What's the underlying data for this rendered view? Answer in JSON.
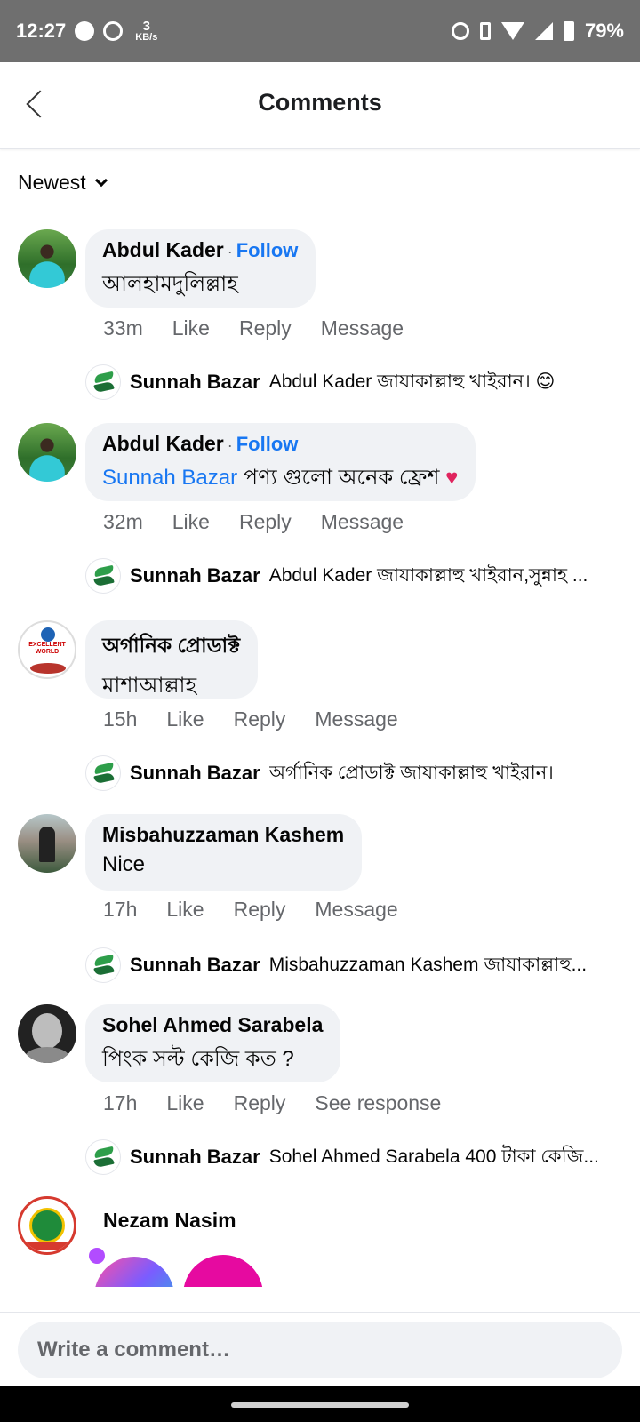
{
  "status_bar": {
    "time": "12:27",
    "net_speed_value": "3",
    "net_speed_unit": "KB/s",
    "battery": "79%"
  },
  "header": {
    "title": "Comments"
  },
  "sort": {
    "label": "Newest"
  },
  "comments": [
    {
      "author": "Abdul Kader",
      "follow": "Follow",
      "text": "আলহামদুলিল্লাহ",
      "time": "33m",
      "like": "Like",
      "reply": "Reply",
      "extra": "Message",
      "reply_preview": {
        "author": "Sunnah Bazar",
        "text": "Abdul Kader জাযাকাল্লাহু খাইরান। 😊"
      }
    },
    {
      "author": "Abdul Kader",
      "follow": "Follow",
      "mention": "Sunnah Bazar",
      "text": " পণ্য গুলো অনেক ফ্রেশ ",
      "emoji": "♥",
      "time": "32m",
      "like": "Like",
      "reply": "Reply",
      "extra": "Message",
      "reply_preview": {
        "author": "Sunnah Bazar",
        "text": "Abdul Kader জাযাকাল্লাহু খাইরান,সুন্নাহ ..."
      }
    },
    {
      "author": "অর্গানিক প্রোডাক্ট",
      "text": "মাশাআল্লাহ",
      "avatar_text": "EXCELLENT WORLD",
      "time": "15h",
      "like": "Like",
      "reply": "Reply",
      "extra": "Message",
      "reply_preview": {
        "author": "Sunnah Bazar",
        "text": "অর্গানিক প্রোডাক্ট জাযাকাল্লাহু খাইরান।"
      }
    },
    {
      "author": "Misbahuzzaman Kashem",
      "text": "Nice",
      "time": "17h",
      "like": "Like",
      "reply": "Reply",
      "extra": "Message",
      "reply_preview": {
        "author": "Sunnah Bazar",
        "text": "Misbahuzzaman Kashem জাযাকাল্লাহু..."
      }
    },
    {
      "author": "Sohel Ahmed Sarabela",
      "text": "পিংক সল্ট কেজি কত ?",
      "time": "17h",
      "like": "Like",
      "reply": "Reply",
      "extra": "See response",
      "reply_preview": {
        "author": "Sunnah Bazar",
        "text": "Sohel Ahmed Sarabela 400 টাকা কেজি..."
      }
    },
    {
      "author": "Nezam Nasim"
    }
  ],
  "composer": {
    "placeholder": "Write a comment…"
  }
}
